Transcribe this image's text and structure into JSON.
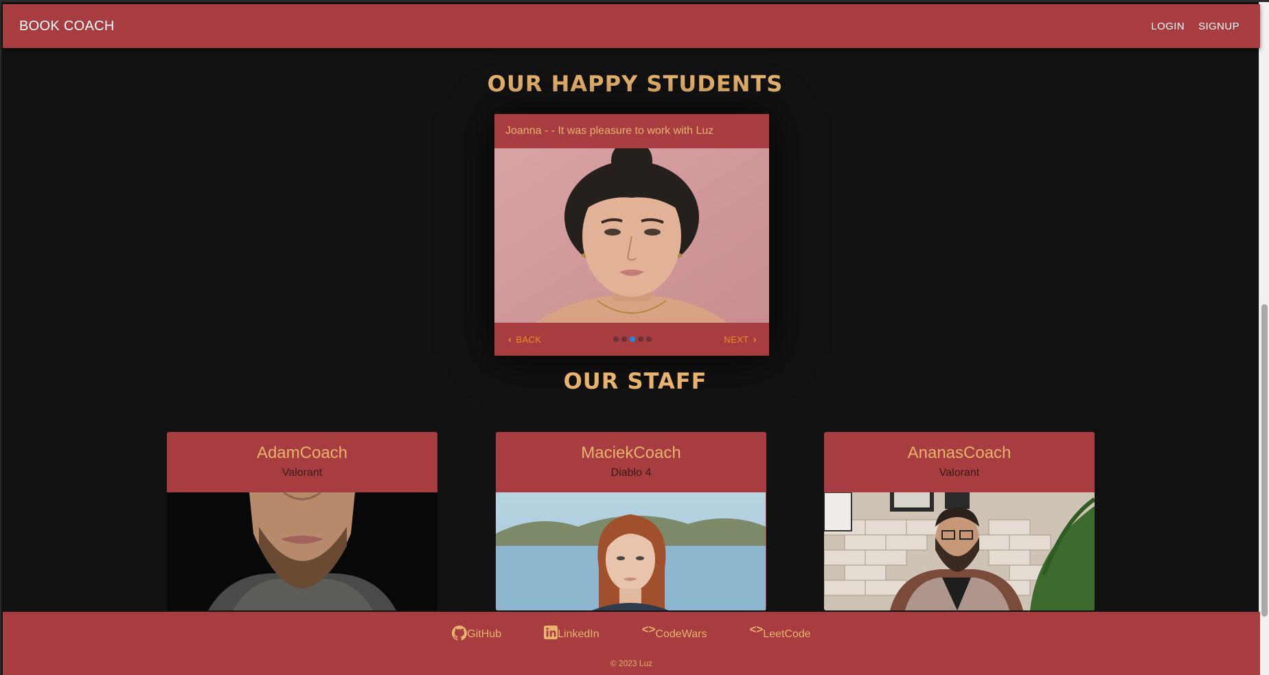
{
  "navbar": {
    "brand": "BOOK COACH",
    "login": "LOGIN",
    "signup": "SIGNUP"
  },
  "testimonials": {
    "title": "OUR HAPPY STUDENTS",
    "caption": "Joanna - - It was pleasure to work with Luz",
    "back": "BACK",
    "next": "NEXT",
    "dot_count": 5,
    "active_dot": 2
  },
  "staff": {
    "title": "OUR STAFF",
    "cards": [
      {
        "name": "AdamCoach",
        "game": "Valorant"
      },
      {
        "name": "MaciekCoach",
        "game": "Diablo 4"
      },
      {
        "name": "AnanasCoach",
        "game": "Valorant"
      }
    ]
  },
  "footer": {
    "links": [
      {
        "label": "GitHub",
        "icon": "github-icon"
      },
      {
        "label": "LinkedIn",
        "icon": "linkedin-icon"
      },
      {
        "label": "CodeWars",
        "icon": "code-icon"
      },
      {
        "label": "LeetCode",
        "icon": "code-icon"
      }
    ],
    "copyright": "© 2023 Luz"
  },
  "colors": {
    "background": "#121212",
    "primary": "#a73d41",
    "accent": "#e8b36c",
    "nav_button": "#f28b1e",
    "active_dot": "#1e88e5"
  }
}
